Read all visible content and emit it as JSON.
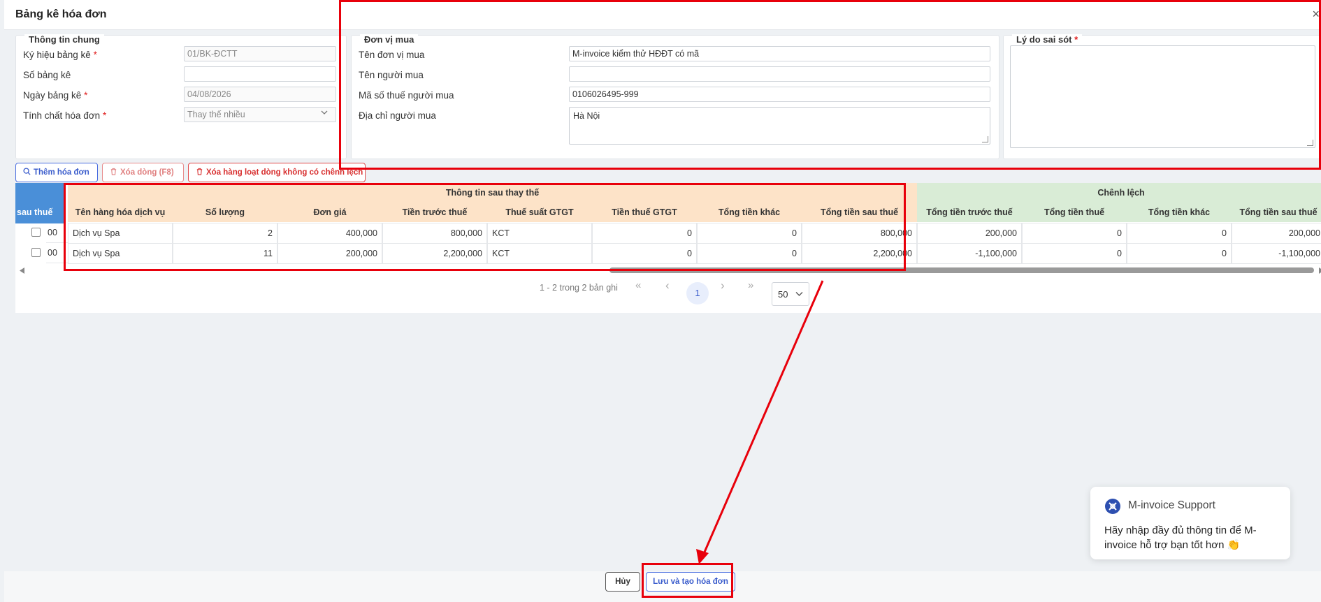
{
  "modal": {
    "title": "Bảng kê hóa đơn",
    "close": "×"
  },
  "general": {
    "legend": "Thông tin chung",
    "symbol_label": "Ký hiệu bảng kê",
    "symbol_value": "01/BK-ĐCTT",
    "number_label": "Số bảng kê",
    "number_value": "",
    "date_label": "Ngày bảng kê",
    "date_value": "04/08/2026",
    "nature_label": "Tính chất hóa đơn",
    "nature_value": "Thay thế nhiều",
    "required_mark": "*"
  },
  "buyer": {
    "legend": "Đơn vị mua",
    "unit_name_label": "Tên đơn vị mua",
    "unit_name_value": "M-invoice kiểm thử HĐĐT có mã",
    "buyer_name_label": "Tên người mua",
    "buyer_name_value": "",
    "tax_code_label": "Mã số thuế người mua",
    "tax_code_value": "0106026495-999",
    "address_label": "Địa chỉ người mua",
    "address_value": "Hà Nội"
  },
  "error_reason": {
    "legend": "Lý do sai sót",
    "required_mark": "*",
    "value": ""
  },
  "toolbar": {
    "add_label": "Thêm hóa đơn",
    "delete_label": "Xóa dòng (F8)",
    "delete_all_label": "Xóa hàng loạt dòng không có chênh lệch"
  },
  "grid": {
    "group_headers": {
      "after_tax_partial": "sau thuế",
      "replacement": "Thông tin sau thay thế",
      "difference": "Chênh lệch"
    },
    "columns": [
      "Tên hàng hóa dịch vụ",
      "Số lượng",
      "Đơn giá",
      "Tiền trước thuế",
      "Thuế suất GTGT",
      "Tiền thuế GTGT",
      "Tổng tiền khác",
      "Tổng tiền sau thuế",
      "Tổng tiền trước thuế",
      "Tổng tiền thuế",
      "Tổng tiền khác",
      "Tổng tiền sau thuế"
    ],
    "rows": [
      {
        "partial": "00",
        "cells": [
          "Dịch vụ Spa",
          "2",
          "400,000",
          "800,000",
          "KCT",
          "0",
          "0",
          "800,000",
          "200,000",
          "0",
          "0",
          "200,000"
        ]
      },
      {
        "partial": "00",
        "cells": [
          "Dịch vụ Spa",
          "11",
          "200,000",
          "2,200,000",
          "KCT",
          "0",
          "0",
          "2,200,000",
          "-1,100,000",
          "0",
          "0",
          "-1,100,000"
        ]
      }
    ]
  },
  "pagination": {
    "summary": "1 - 2 trong 2 bản ghi",
    "current_page": "1",
    "page_size": "50",
    "first": "«",
    "prev": "‹",
    "next": "›",
    "last": "»"
  },
  "footer": {
    "cancel_label": "Hủy",
    "save_label": "Lưu và tạo hóa đơn"
  },
  "support": {
    "title": "M-invoice Support",
    "message": "Hãy nhập đầy đủ thông tin để M-invoice hỗ trợ bạn tốt hơn 👏"
  },
  "colors": {
    "replacement_header": "#fde3c8",
    "difference_header": "#d9ecd6",
    "accent": "#3a5ccc",
    "annotation": "#e8000b"
  }
}
